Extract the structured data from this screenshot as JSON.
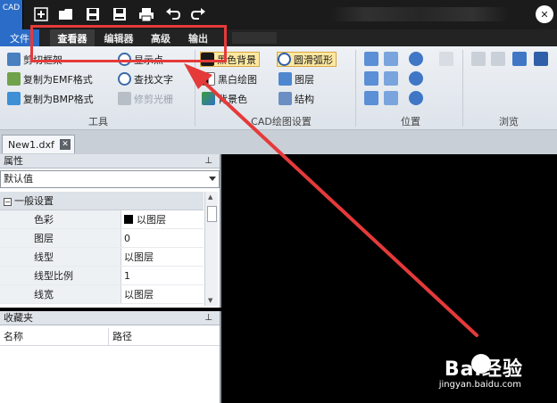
{
  "app": {
    "logo_text": "CAD"
  },
  "quick_access": [
    "new-icon",
    "open-icon",
    "save-icon",
    "save-as-icon",
    "print-icon",
    "undo-icon",
    "redo-icon"
  ],
  "menu": {
    "file": "文件",
    "tabs": [
      {
        "label": "查看器",
        "active": true
      },
      {
        "label": "编辑器",
        "active": false
      },
      {
        "label": "高级",
        "active": false
      },
      {
        "label": "输出",
        "active": false
      }
    ]
  },
  "ribbon": {
    "tools": {
      "items": [
        {
          "label": "剪切框架",
          "disabled": false
        },
        {
          "label": "复制为EMF格式",
          "disabled": false
        },
        {
          "label": "复制为BMP格式",
          "disabled": false
        },
        {
          "label": "显示点",
          "disabled": false
        },
        {
          "label": "查找文字",
          "disabled": false
        },
        {
          "label": "修剪光栅",
          "disabled": true
        }
      ],
      "group_label": "工具"
    },
    "cad_settings": {
      "items": [
        {
          "label": "黑色背景",
          "checked": true
        },
        {
          "label": "黑白绘图",
          "checked": false
        },
        {
          "label": "背景色",
          "checked": false
        },
        {
          "label": "圆滑弧形",
          "checked": true
        },
        {
          "label": "图层",
          "checked": false
        },
        {
          "label": "结构",
          "checked": false
        }
      ],
      "group_label": "CAD绘图设置"
    },
    "position": {
      "group_label": "位置"
    },
    "browse": {
      "group_label": "浏览"
    }
  },
  "document_tab": {
    "label": "New1.dxf",
    "close": "✕"
  },
  "properties": {
    "title": "属性",
    "pin": "⊥",
    "combo_value": "默认值",
    "category": "一般设置",
    "rows": [
      {
        "name": "色彩",
        "value": "以图层",
        "swatch": "#000000"
      },
      {
        "name": "图层",
        "value": "0"
      },
      {
        "name": "线型",
        "value": "以图层"
      },
      {
        "name": "线型比例",
        "value": "1"
      },
      {
        "name": "线宽",
        "value": "以图层"
      }
    ]
  },
  "favorites": {
    "title": "收藏夹",
    "pin": "⊥",
    "columns": [
      "名称",
      "路径"
    ]
  },
  "watermark": {
    "brand": "Bai经验",
    "url": "jingyan.baidu.com"
  },
  "colors": {
    "accent": "#2a6cc7",
    "annotation": "#e53a3a",
    "canvas": "#000000"
  }
}
